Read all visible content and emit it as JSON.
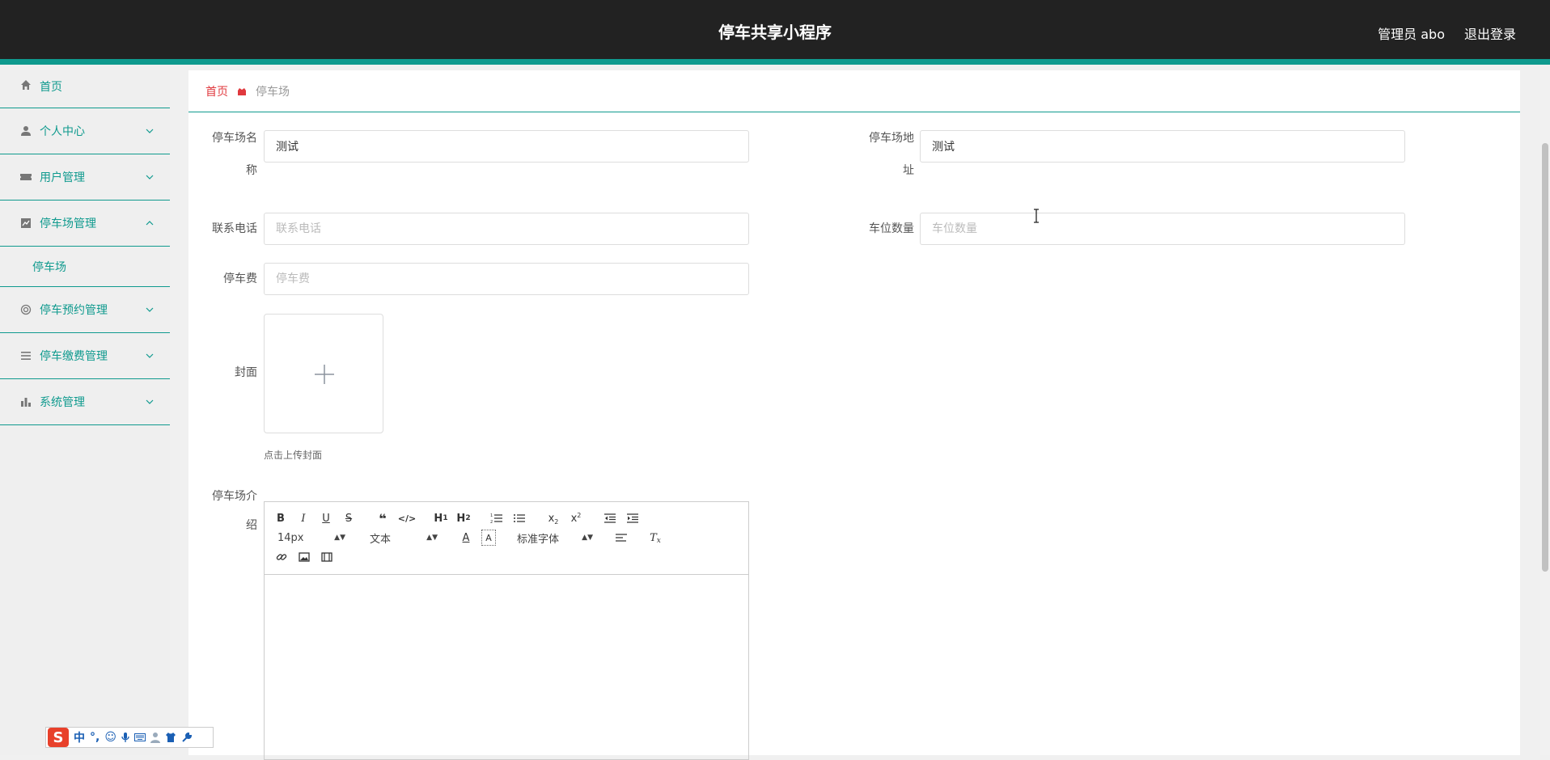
{
  "header": {
    "title": "停车共享小程序",
    "admin": "管理员 abo",
    "logout": "退出登录"
  },
  "sidebar": {
    "items": [
      {
        "label": "首页",
        "icon": "home-icon"
      },
      {
        "label": "个人中心",
        "icon": "user-icon"
      },
      {
        "label": "用户管理",
        "icon": "ticket-icon"
      },
      {
        "label": "停车场管理",
        "icon": "chart-icon",
        "expanded": true,
        "sub": [
          {
            "label": "停车场"
          }
        ]
      },
      {
        "label": "停车预约管理",
        "icon": "ring-icon"
      },
      {
        "label": "停车缴费管理",
        "icon": "list-icon"
      },
      {
        "label": "系统管理",
        "icon": "bar-chart-icon"
      }
    ]
  },
  "breadcrumb": {
    "home": "首页",
    "current": "停车场"
  },
  "form": {
    "name": {
      "label_line1": "停车场名",
      "label_line2": "称",
      "value": "测试"
    },
    "address": {
      "label_line1": "停车场地",
      "label_line2": "址",
      "value": "测试"
    },
    "phone": {
      "label": "联系电话",
      "placeholder": "联系电话",
      "value": ""
    },
    "spaces": {
      "label": "车位数量",
      "placeholder": "车位数量",
      "value": ""
    },
    "fee": {
      "label": "停车费",
      "placeholder": "停车费",
      "value": ""
    },
    "cover": {
      "label": "封面",
      "tip": "点击上传封面"
    },
    "intro": {
      "label_line1": "停车场介",
      "label_line2": "绍"
    }
  },
  "editor": {
    "font_size": "14px",
    "paragraph": "文本",
    "font_family": "标准字体"
  },
  "colors": {
    "accent": "#0f9a8e",
    "header_bg": "#222222",
    "breadcrumb_home": "#e0393e"
  }
}
